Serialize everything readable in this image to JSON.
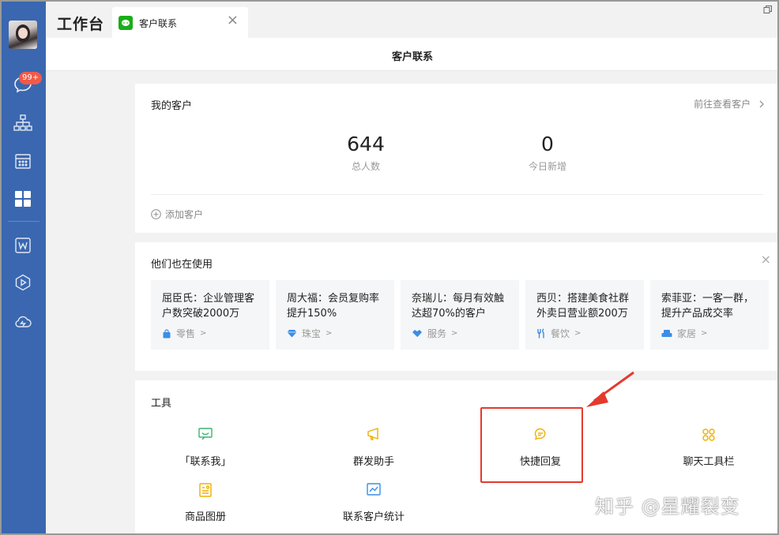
{
  "sidebar": {
    "badge": "99+",
    "items": [
      {
        "icon": "chat-icon"
      },
      {
        "icon": "org-chart-icon"
      },
      {
        "icon": "calendar-icon"
      },
      {
        "icon": "workbench-grid-icon"
      },
      {
        "icon": "word-doc-icon"
      },
      {
        "icon": "play-icon"
      },
      {
        "icon": "cloud-icon"
      }
    ]
  },
  "header": {
    "app_title": "工作台",
    "tab_label": "客户联系",
    "tab_close": "×"
  },
  "page": {
    "title": "客户联系"
  },
  "my_customers": {
    "title": "我的客户",
    "view_link": "前往查看客户",
    "stats": [
      {
        "value": "644",
        "label": "总人数"
      },
      {
        "value": "0",
        "label": "今日新增"
      }
    ],
    "add_label": "添加客户"
  },
  "also_using": {
    "title": "他们也在使用",
    "close": "×",
    "cases": [
      {
        "text": "屈臣氏：企业管理客户数突破2000万",
        "tag": "零售",
        "icon": "shopping-bag-icon"
      },
      {
        "text": "周大福：会员复购率提升150%",
        "tag": "珠宝",
        "icon": "diamond-icon"
      },
      {
        "text": "奈瑞儿：每月有效触达超70%的客户",
        "tag": "服务",
        "icon": "handshake-icon"
      },
      {
        "text": "西贝：搭建美食社群外卖日营业额200万",
        "tag": "餐饮",
        "icon": "cutlery-icon"
      },
      {
        "text": "索菲亚：一客一群，提升产品成交率",
        "tag": "家居",
        "icon": "sofa-icon"
      }
    ],
    "tag_arrow": ">"
  },
  "tools": {
    "title": "工具",
    "items": [
      {
        "label": "「联系我」",
        "icon": "contact-me-icon"
      },
      {
        "label": "群发助手",
        "icon": "broadcast-icon"
      },
      {
        "label": "快捷回复",
        "icon": "quick-reply-icon"
      },
      {
        "label": "聊天工具栏",
        "icon": "chat-toolbar-icon"
      },
      {
        "label": "商品图册",
        "icon": "product-album-icon"
      },
      {
        "label": "联系客户统计",
        "icon": "statistics-icon"
      }
    ]
  },
  "watermark": "知乎 @星耀裂变",
  "colors": {
    "sidebar": "#3a67b0",
    "accent_green": "#1aad19",
    "tool_green": "#3cb371",
    "tool_yellow": "#f0b000",
    "tool_blue": "#3a8ee6",
    "badge_red": "#f25a48",
    "highlight_red": "#e43a2d"
  }
}
